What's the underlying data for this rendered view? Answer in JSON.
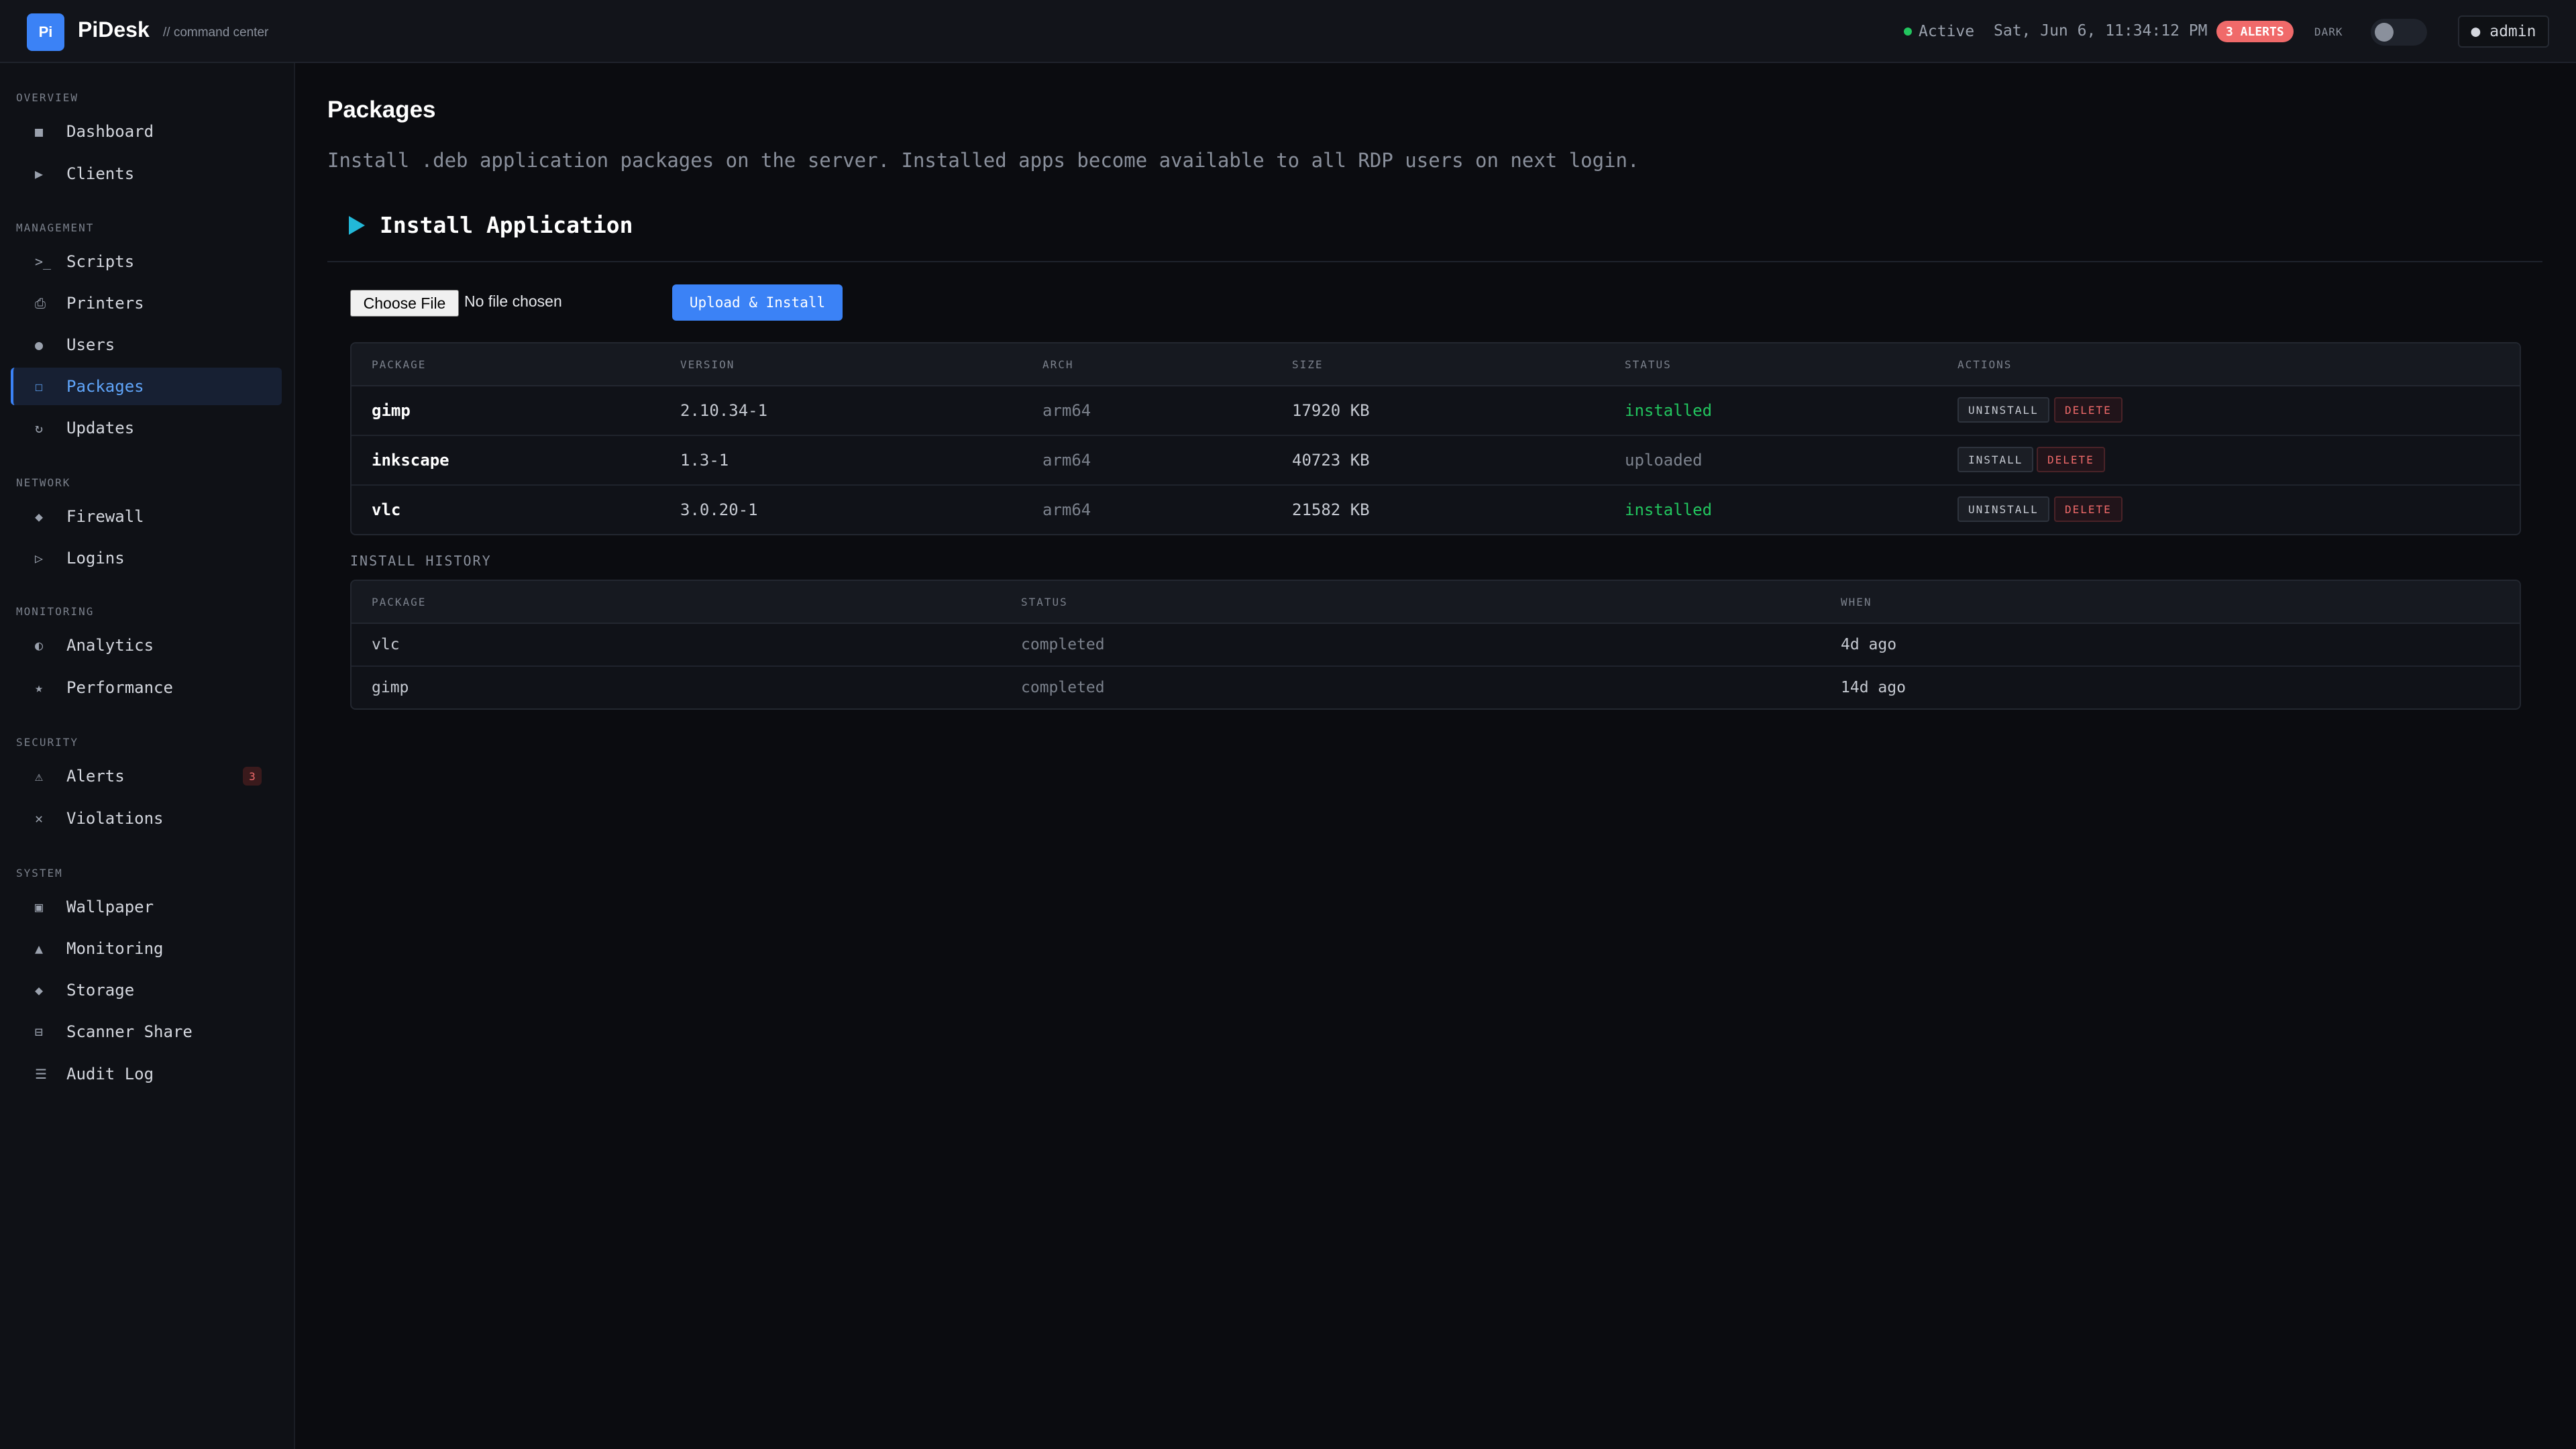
{
  "header": {
    "logo": "Pi",
    "app_name": "PiDesk",
    "subtitle": "// command center",
    "status": "Active",
    "datetime": "Sat, Jun 6, 11:34:12 PM",
    "alerts": "3 ALERTS",
    "theme_label": "DARK",
    "user": "● admin"
  },
  "sidebar": {
    "overview": "OVERVIEW",
    "management": "MANAGEMENT",
    "network": "NETWORK",
    "monitoring": "MONITORING",
    "security": "SECURITY",
    "system": "SYSTEM",
    "items": [
      {
        "label": "Dashboard",
        "icon": "■"
      },
      {
        "label": "Clients",
        "icon": "▶"
      },
      {
        "label": "Scripts",
        "icon": ">_"
      },
      {
        "label": "Printers",
        "icon": "⎙"
      },
      {
        "label": "Users",
        "icon": "●"
      },
      {
        "label": "Packages",
        "icon": "☐"
      },
      {
        "label": "Updates",
        "icon": "↻"
      },
      {
        "label": "Firewall",
        "icon": "◆"
      },
      {
        "label": "Logins",
        "icon": "▷"
      },
      {
        "label": "Analytics",
        "icon": "◐"
      },
      {
        "label": "Performance",
        "icon": "★"
      },
      {
        "label": "Alerts",
        "icon": "⚠",
        "badge": "3"
      },
      {
        "label": "Violations",
        "icon": "✕"
      },
      {
        "label": "Wallpaper",
        "icon": "▣"
      },
      {
        "label": "Monitoring",
        "icon": "▲"
      },
      {
        "label": "Storage",
        "icon": "◆"
      },
      {
        "label": "Scanner Share",
        "icon": "⊟"
      },
      {
        "label": "Audit Log",
        "icon": "☰"
      }
    ],
    "active": "Packages"
  },
  "main": {
    "title": "Packages",
    "description": "Install .deb application packages on the server. Installed apps become available to all RDP users on next login.",
    "section_title": "Install Application",
    "file_button": "Choose File",
    "file_status": "No file chosen",
    "upload_button": "Upload & Install",
    "packages": {
      "headers": [
        "PACKAGE",
        "VERSION",
        "ARCH",
        "SIZE",
        "STATUS",
        "ACTIONS"
      ],
      "rows": [
        {
          "package": "gimp",
          "version": "2.10.34-1",
          "arch": "arm64",
          "size": "17920 KB",
          "status": "installed",
          "action1": "UNINSTALL",
          "action2": "DELETE"
        },
        {
          "package": "inkscape",
          "version": "1.3-1",
          "arch": "arm64",
          "size": "40723 KB",
          "status": "uploaded",
          "action1": "INSTALL",
          "action2": "DELETE"
        },
        {
          "package": "vlc",
          "version": "3.0.20-1",
          "arch": "arm64",
          "size": "21582 KB",
          "status": "installed",
          "action1": "UNINSTALL",
          "action2": "DELETE"
        }
      ]
    },
    "history": {
      "label": "INSTALL HISTORY",
      "headers": [
        "PACKAGE",
        "STATUS",
        "WHEN"
      ],
      "rows": [
        {
          "package": "vlc",
          "status": "completed",
          "when": "4d ago"
        },
        {
          "package": "gimp",
          "status": "completed",
          "when": "14d ago"
        }
      ]
    }
  }
}
